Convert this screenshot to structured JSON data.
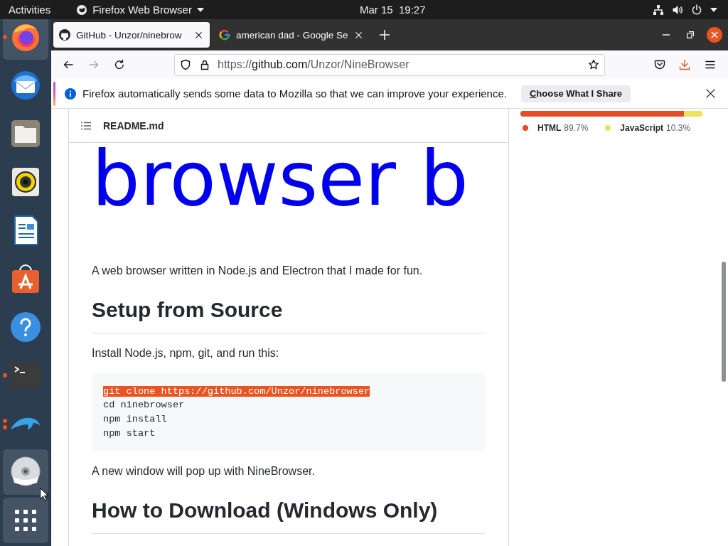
{
  "top_bar": {
    "activities": "Activities",
    "app_menu": "Firefox Web Browser",
    "clock": "Mar 15  19:27"
  },
  "dock": {
    "items": [
      {
        "kind": "browser",
        "highlighted": true,
        "running": true,
        "multi_window": false
      },
      {
        "kind": "mail",
        "highlighted": false,
        "running": false,
        "multi_window": false
      },
      {
        "kind": "files",
        "highlighted": false,
        "running": false,
        "multi_window": false
      },
      {
        "kind": "music",
        "highlighted": false,
        "running": false,
        "multi_window": false
      },
      {
        "kind": "writer",
        "highlighted": false,
        "running": false,
        "multi_window": false
      },
      {
        "kind": "store",
        "highlighted": false,
        "running": false,
        "multi_window": false
      },
      {
        "kind": "help",
        "highlighted": false,
        "running": false,
        "multi_window": false
      },
      {
        "kind": "terminal",
        "highlighted": false,
        "running": true,
        "multi_window": false
      },
      {
        "kind": "dolphin",
        "highlighted": false,
        "running": true,
        "multi_window": true
      },
      {
        "kind": "disc",
        "highlighted": true,
        "running": false,
        "multi_window": false
      },
      {
        "kind": "apps",
        "highlighted": true,
        "running": false,
        "multi_window": false
      }
    ]
  },
  "tabs": [
    {
      "kind": "github",
      "title": "GitHub - Unzor/ninebrow",
      "selected": true
    },
    {
      "kind": "google",
      "title": "american dad - Google Se",
      "selected": false
    }
  ],
  "toolbar": {
    "nav_buttons": [
      {
        "kind": "back",
        "disabled": false
      },
      {
        "kind": "forward",
        "disabled": true
      },
      {
        "kind": "reload",
        "disabled": false
      }
    ],
    "url": {
      "scheme": "https://",
      "host": "github.com",
      "path": "/Unzor/NineBrowser"
    }
  },
  "notification": {
    "message": "Firefox automatically sends some data to Mozilla so that we can improve your experience.",
    "button": "Choose What I Share",
    "access_key_underlined": true
  },
  "readme": {
    "file_name": "README.md",
    "logo_text": "browser b",
    "blocks": [
      {
        "kind": "paragraph",
        "text": "A web browser written in Node.js and Electron that I made for fun."
      },
      {
        "kind": "heading",
        "text": "Setup from Source"
      },
      {
        "kind": "paragraph",
        "text": "Install Node.js, npm, git, and run this:"
      },
      {
        "kind": "code",
        "lines": [
          {
            "text": "git clone https://github.com/Unzor/ninebrowser",
            "selected": true
          },
          {
            "text": "cd ninebrowser",
            "selected": false
          },
          {
            "text": "npm install",
            "selected": false
          },
          {
            "text": "npm start",
            "selected": false
          }
        ]
      },
      {
        "kind": "paragraph",
        "text": "A new window will pop up with NineBrowser."
      },
      {
        "kind": "heading",
        "text": "How to Download (Windows Only)"
      }
    ]
  },
  "languages": [
    {
      "name": "HTML",
      "share": "89.7%",
      "level": 0.897,
      "color": "#e34c26"
    },
    {
      "name": "JavaScript",
      "share": "10.3%",
      "level": 0.103,
      "color": "#f1e05a"
    }
  ]
}
